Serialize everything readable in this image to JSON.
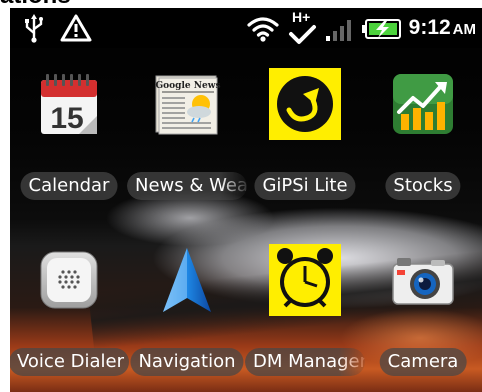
{
  "page": {
    "heading_fragment": "ations"
  },
  "status_bar": {
    "icons": [
      "usb-icon",
      "warning-icon",
      "wifi-icon",
      "hplus-data-icon",
      "signal-bars-icon",
      "battery-charging-icon"
    ],
    "time": "9:12",
    "ampm": "AM",
    "network_label": "H+"
  },
  "apps": [
    {
      "label": "Calendar",
      "icon": "calendar-icon",
      "calendar_day": "15"
    },
    {
      "label": "News & Weather",
      "icon": "news-weather-icon",
      "header_text": "Google News"
    },
    {
      "label": "GiPSi Lite",
      "icon": "gipsi-lite-icon"
    },
    {
      "label": "Stocks",
      "icon": "stocks-icon"
    },
    {
      "label": "Voice Dialer",
      "icon": "voice-dialer-icon"
    },
    {
      "label": "Navigation",
      "icon": "navigation-icon"
    },
    {
      "label": "DM Manager",
      "icon": "dm-manager-icon"
    },
    {
      "label": "Camera",
      "icon": "camera-icon"
    }
  ],
  "colors": {
    "gipsi_yellow": "#ffee00",
    "dm_yellow": "#ffee00",
    "stocks_green": "#2e7d32",
    "navigation_blue": "#1e88e5",
    "calendar_red": "#d32f2f"
  }
}
